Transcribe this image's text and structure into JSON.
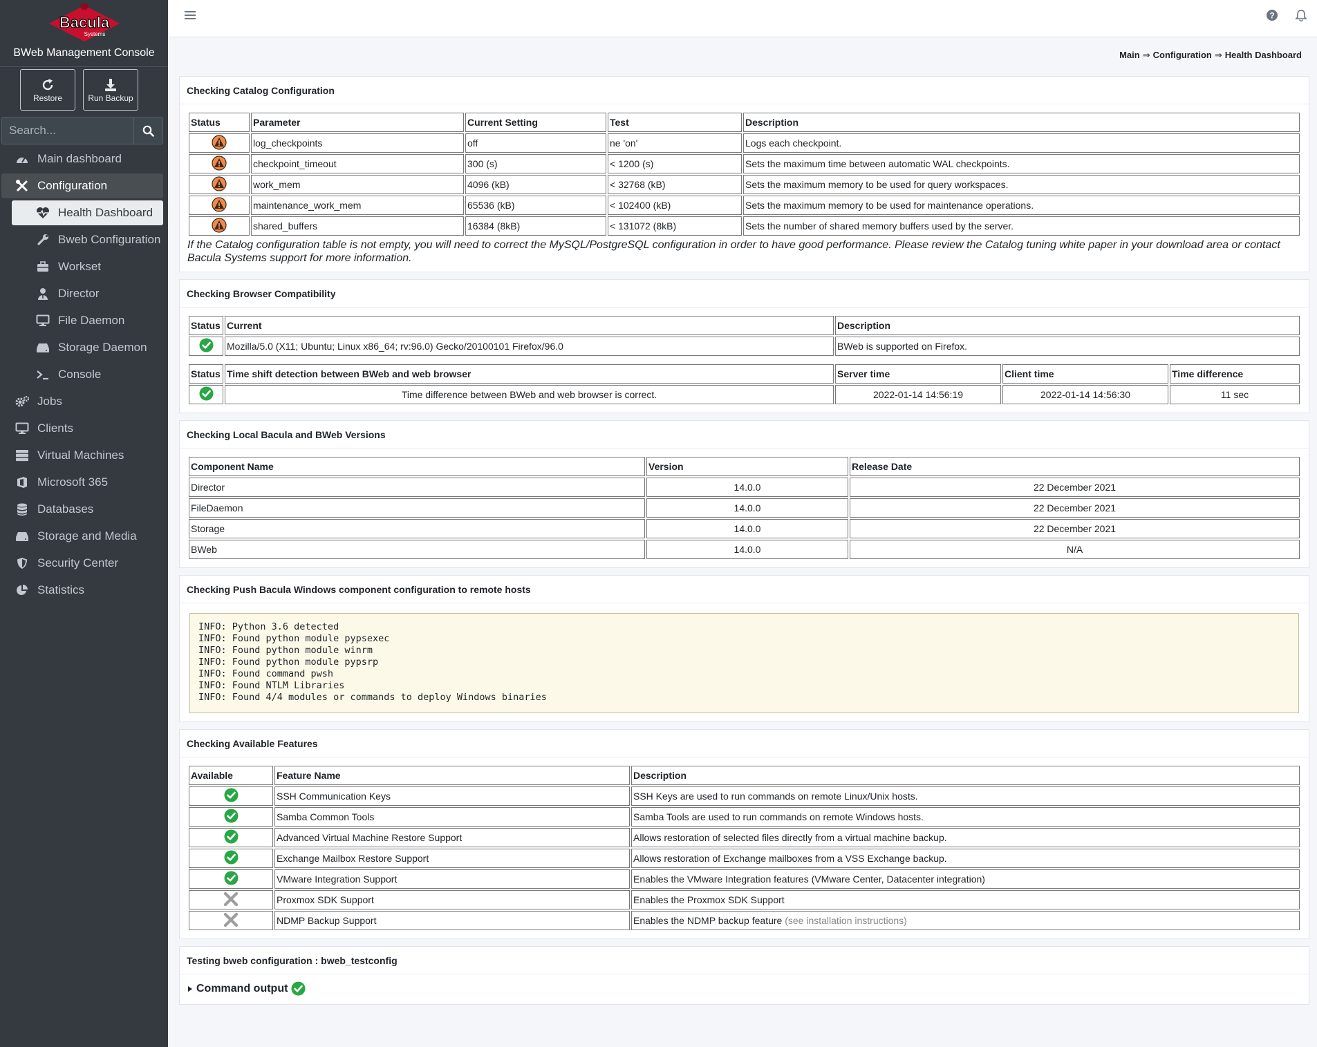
{
  "sidebar": {
    "logo_text": "Bacula",
    "logo_subtext": "Systems",
    "brand_title": "BWeb Management Console",
    "restore_label": "Restore",
    "run_backup_label": "Run Backup",
    "search_placeholder": "Search...",
    "nav": [
      {
        "label": "Main dashboard",
        "icon": "tachometer-icon"
      },
      {
        "label": "Configuration",
        "icon": "tools-icon"
      },
      {
        "label": "Health Dashboard",
        "icon": "heartbeat-icon"
      },
      {
        "label": "Bweb Configuration",
        "icon": "wrench-icon"
      },
      {
        "label": "Workset",
        "icon": "toolbox-icon"
      },
      {
        "label": "Director",
        "icon": "user-tie-icon"
      },
      {
        "label": "File Daemon",
        "icon": "desktop-icon"
      },
      {
        "label": "Storage Daemon",
        "icon": "hdd-icon"
      },
      {
        "label": "Console",
        "icon": "terminal-icon"
      },
      {
        "label": "Jobs",
        "icon": "cogs-icon"
      },
      {
        "label": "Clients",
        "icon": "desktop-icon"
      },
      {
        "label": "Virtual Machines",
        "icon": "server-icon"
      },
      {
        "label": "Microsoft 365",
        "icon": "office-icon"
      },
      {
        "label": "Databases",
        "icon": "database-icon"
      },
      {
        "label": "Storage and Media",
        "icon": "hdd-icon"
      },
      {
        "label": "Security Center",
        "icon": "shield-icon"
      },
      {
        "label": "Statistics",
        "icon": "pie-chart-icon"
      }
    ]
  },
  "breadcrumb": {
    "main": "Main",
    "configuration": "Configuration",
    "current": "Health Dashboard",
    "separator": "⇒"
  },
  "catalog": {
    "title": "Checking Catalog Configuration",
    "headers": [
      "Status",
      "Parameter",
      "Current Setting",
      "Test",
      "Description"
    ],
    "rows": [
      [
        "warning",
        "log_checkpoints",
        "off",
        "ne 'on'",
        "Logs each checkpoint."
      ],
      [
        "warning",
        "checkpoint_timeout",
        "300 (s)",
        "< 1200 (s)",
        "Sets the maximum time between automatic WAL checkpoints."
      ],
      [
        "warning",
        "work_mem",
        "4096 (kB)",
        "< 32768 (kB)",
        "Sets the maximum memory to be used for query workspaces."
      ],
      [
        "warning",
        "maintenance_work_mem",
        "65536 (kB)",
        "< 102400 (kB)",
        "Sets the maximum memory to be used for maintenance operations."
      ],
      [
        "warning",
        "shared_buffers",
        "16384 (8kB)",
        "< 131072 (8kB)",
        "Sets the number of shared memory buffers used by the server."
      ]
    ],
    "note": "If the Catalog configuration table is not empty, you will need to correct the MySQL/PostgreSQL configuration in order to have good performance. Please review the Catalog tuning white paper in your download area or contact Bacula Systems support for more information."
  },
  "browser": {
    "title": "Checking Browser Compatibility",
    "headers": [
      "Status",
      "Current",
      "Description"
    ],
    "row": [
      "ok",
      "Mozilla/5.0 (X11; Ubuntu; Linux x86_64; rv:96.0) Gecko/20100101 Firefox/96.0",
      "BWeb is supported on Firefox."
    ],
    "time_headers": [
      "Status",
      "Time shift detection between BWeb and web browser",
      "Server time",
      "Client time",
      "Time difference"
    ],
    "time_row": [
      "ok",
      "Time difference between BWeb and web browser is correct.",
      "2022-01-14 14:56:19",
      "2022-01-14 14:56:30",
      "11 sec"
    ]
  },
  "versions": {
    "title": "Checking Local Bacula and BWeb Versions",
    "headers": [
      "Component Name",
      "Version",
      "Release Date"
    ],
    "rows": [
      [
        "Director",
        "14.0.0",
        "22 December 2021"
      ],
      [
        "FileDaemon",
        "14.0.0",
        "22 December 2021"
      ],
      [
        "Storage",
        "14.0.0",
        "22 December 2021"
      ],
      [
        "BWeb",
        "14.0.0",
        "N/A"
      ]
    ]
  },
  "push": {
    "title": "Checking Push Bacula Windows component configuration to remote hosts",
    "output": "INFO: Python 3.6 detected\nINFO: Found python module pypsexec\nINFO: Found python module winrm\nINFO: Found python module pypsrp\nINFO: Found command pwsh\nINFO: Found NTLM Libraries\nINFO: Found 4/4 modules or commands to deploy Windows binaries"
  },
  "features": {
    "title": "Checking Available Features",
    "headers": [
      "Available",
      "Feature Name",
      "Description"
    ],
    "rows": [
      [
        "ok",
        "SSH Communication Keys",
        "SSH Keys are used to run commands on remote Linux/Unix hosts."
      ],
      [
        "ok",
        "Samba Common Tools",
        "Samba Tools are used to run commands on remote Windows hosts."
      ],
      [
        "ok",
        "Advanced Virtual Machine Restore Support",
        "Allows restoration of selected files directly from a virtual machine backup."
      ],
      [
        "ok",
        "Exchange Mailbox Restore Support",
        "Allows restoration of Exchange mailboxes from a VSS Exchange backup."
      ],
      [
        "ok",
        "VMware Integration Support",
        "Enables the VMware Integration features (VMware Center, Datacenter integration)"
      ],
      [
        "no",
        "Proxmox SDK Support",
        "Enables the Proxmox SDK Support"
      ],
      [
        "no",
        "NDMP Backup Support",
        "Enables the NDMP backup feature"
      ]
    ],
    "ndmp_link": "(see installation instructions)"
  },
  "testconfig": {
    "title": "Testing bweb configuration : bweb_testconfig",
    "summary": "Command output"
  },
  "colors": {
    "sidebar_bg": "#343a40",
    "ok": "#28a745",
    "warning": "#f0894a",
    "no": "#9e9e9e"
  }
}
